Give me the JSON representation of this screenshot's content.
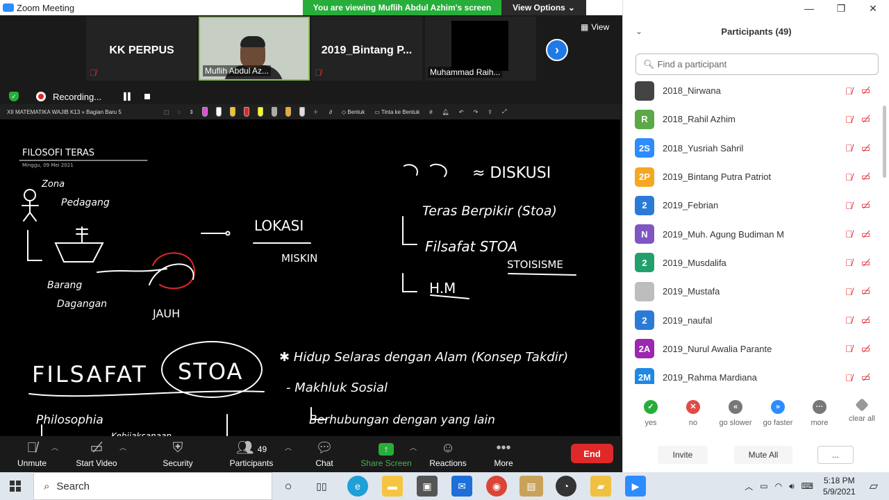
{
  "window": {
    "title": "Zoom Meeting",
    "viewing_banner": "You are viewing Muflih Abdul Azhim's screen",
    "view_options": "View Options"
  },
  "gallery": {
    "tiles": [
      "KK PERPUS",
      "Muflih Abdul Az...",
      "2019_Bintang  P...",
      "Muhammad Raih..."
    ],
    "view_label": "View"
  },
  "recording": {
    "label": "Recording..."
  },
  "whiteboard": {
    "section": "XII MATEMATIKA WAJIB K13 » Bagian Baru 5",
    "tool_shape": "Bentuk",
    "tool_ink": "Tinta ke Bentuk",
    "title": "FILOSOFI TERAS",
    "date": "Minggu, 09 Mei 2021"
  },
  "controls": {
    "unmute": "Unmute",
    "start_video": "Start Video",
    "security": "Security",
    "participants": "Participants",
    "participants_count": "49",
    "chat": "Chat",
    "share_screen": "Share Screen",
    "reactions": "Reactions",
    "more": "More",
    "end": "End"
  },
  "panel": {
    "title": "Participants (49)",
    "search_placeholder": "Find a participant",
    "participants": [
      {
        "initials": "",
        "name": "2018_Nirwana",
        "color": "#444444"
      },
      {
        "initials": "R",
        "name": "2018_Rahil Azhim",
        "color": "#5aa846"
      },
      {
        "initials": "2S",
        "name": "2018_Yusriah Sahril",
        "color": "#2d8cff"
      },
      {
        "initials": "2P",
        "name": "2019_Bintang Putra Patriot",
        "color": "#f5a623"
      },
      {
        "initials": "2",
        "name": "2019_Febrian",
        "color": "#2b7bd6"
      },
      {
        "initials": "N",
        "name": "2019_Muh. Agung Budiman M",
        "color": "#7e57c2"
      },
      {
        "initials": "2",
        "name": "2019_Musdalifa",
        "color": "#22a06b"
      },
      {
        "initials": "",
        "name": "2019_Mustafa",
        "color": "#bdbdbd"
      },
      {
        "initials": "2",
        "name": "2019_naufal",
        "color": "#2b7bd6"
      },
      {
        "initials": "2A",
        "name": "2019_Nurul Awalia Parante",
        "color": "#9c27b0"
      },
      {
        "initials": "2M",
        "name": "2019_Rahma Mardiana",
        "color": "#1e88e5"
      }
    ],
    "feedback": [
      "yes",
      "no",
      "go slower",
      "go faster",
      "more",
      "clear all"
    ],
    "invite": "Invite",
    "mute_all": "Mute All",
    "more_btn": "..."
  },
  "taskbar": {
    "search": "Search",
    "time": "5:18 PM",
    "date": "5/9/2021"
  },
  "colors": {
    "accent": "#2d8cff",
    "end": "#e02828",
    "share": "#27ae3a"
  }
}
